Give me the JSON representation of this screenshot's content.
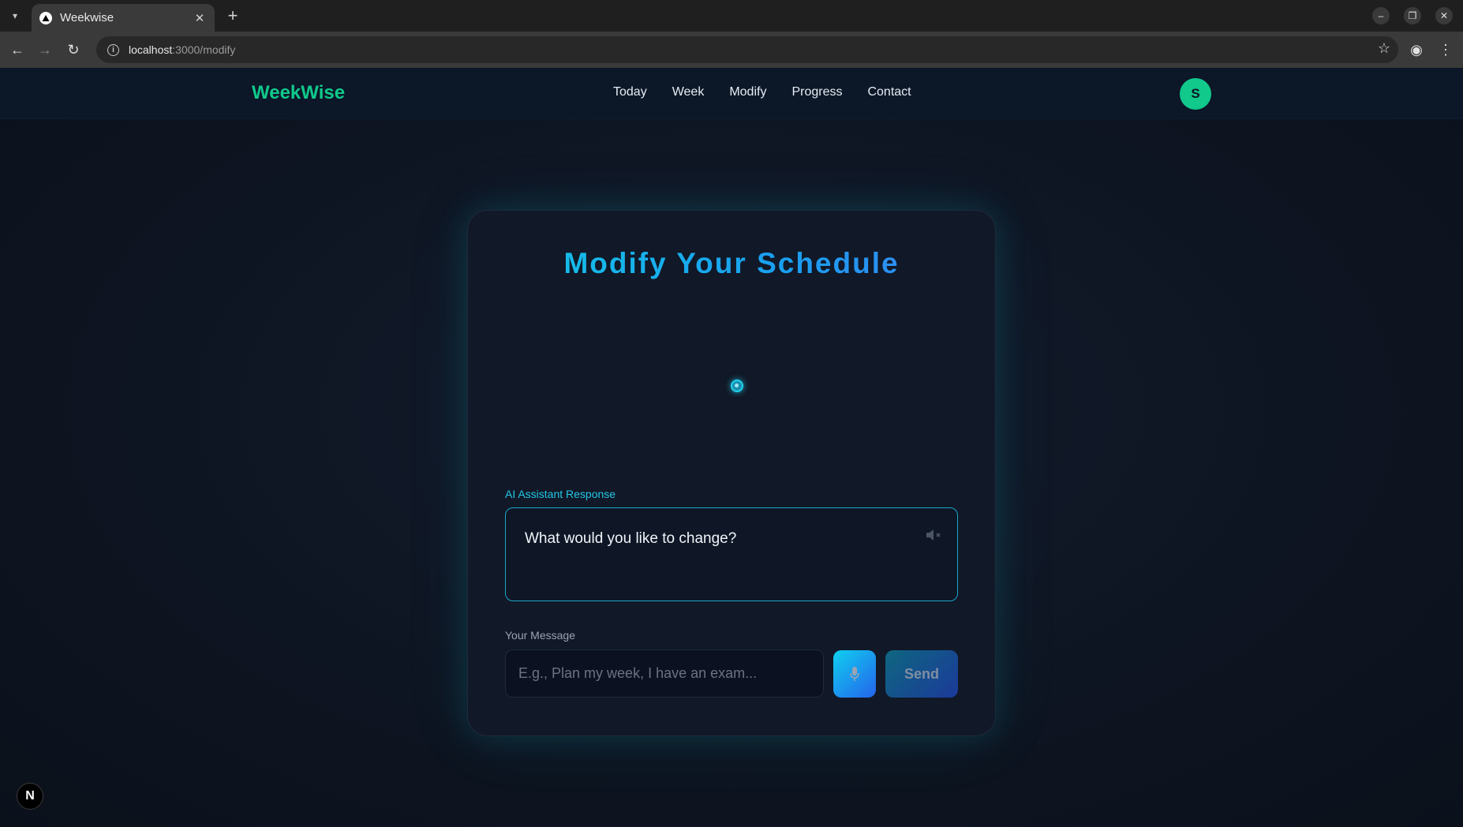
{
  "browser": {
    "tab_title": "Weekwise",
    "tab_dropdown_icon": "chevron-down-icon",
    "tab_close": "✕",
    "new_tab": "+",
    "url_host": "localhost",
    "url_path": ":3000/modify"
  },
  "app": {
    "brand": "WeekWise",
    "nav": [
      "Today",
      "Week",
      "Modify",
      "Progress",
      "Contact"
    ],
    "avatar_initial": "S",
    "accent_color": "#10c98b"
  },
  "card": {
    "title": "Modify Your Schedule",
    "ai_label": "AI Assistant Response",
    "ai_response": "What would you like to change?",
    "message_label": "Your Message",
    "message_placeholder": "E.g., Plan my week, I have an exam...",
    "message_value": "",
    "send_label": "Send",
    "title_gradient": [
      "#14c7e6",
      "#3b82f6"
    ]
  },
  "dev_badge": "N"
}
